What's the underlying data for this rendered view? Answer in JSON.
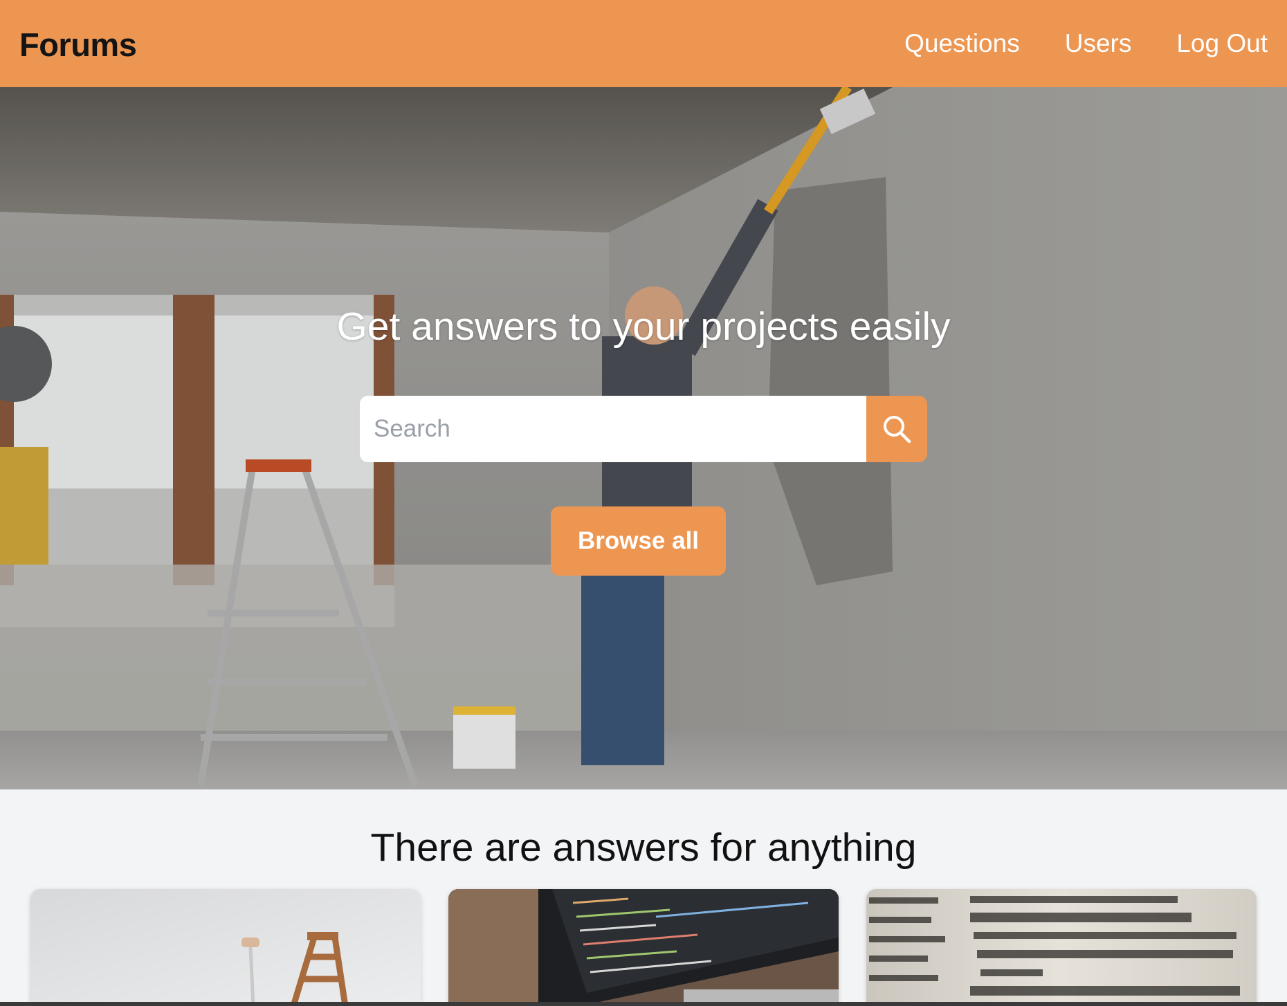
{
  "navbar": {
    "brand": "Forums",
    "links": [
      {
        "label": "Questions"
      },
      {
        "label": "Users"
      },
      {
        "label": "Log Out"
      }
    ],
    "color": "#ed9651"
  },
  "hero": {
    "title": "Get answers to your projects easily",
    "search": {
      "placeholder": "Search",
      "value": "",
      "button_icon": "search-icon"
    },
    "browse_label": "Browse all"
  },
  "section": {
    "title": "There are answers for anything",
    "cards": [
      {
        "image": "paint-roller-ladder-photo"
      },
      {
        "image": "laptop-code-photo"
      },
      {
        "image": "dictionary-page-photo"
      }
    ]
  },
  "colors": {
    "accent": "#ed9651",
    "page_background": "#f3f4f6"
  }
}
